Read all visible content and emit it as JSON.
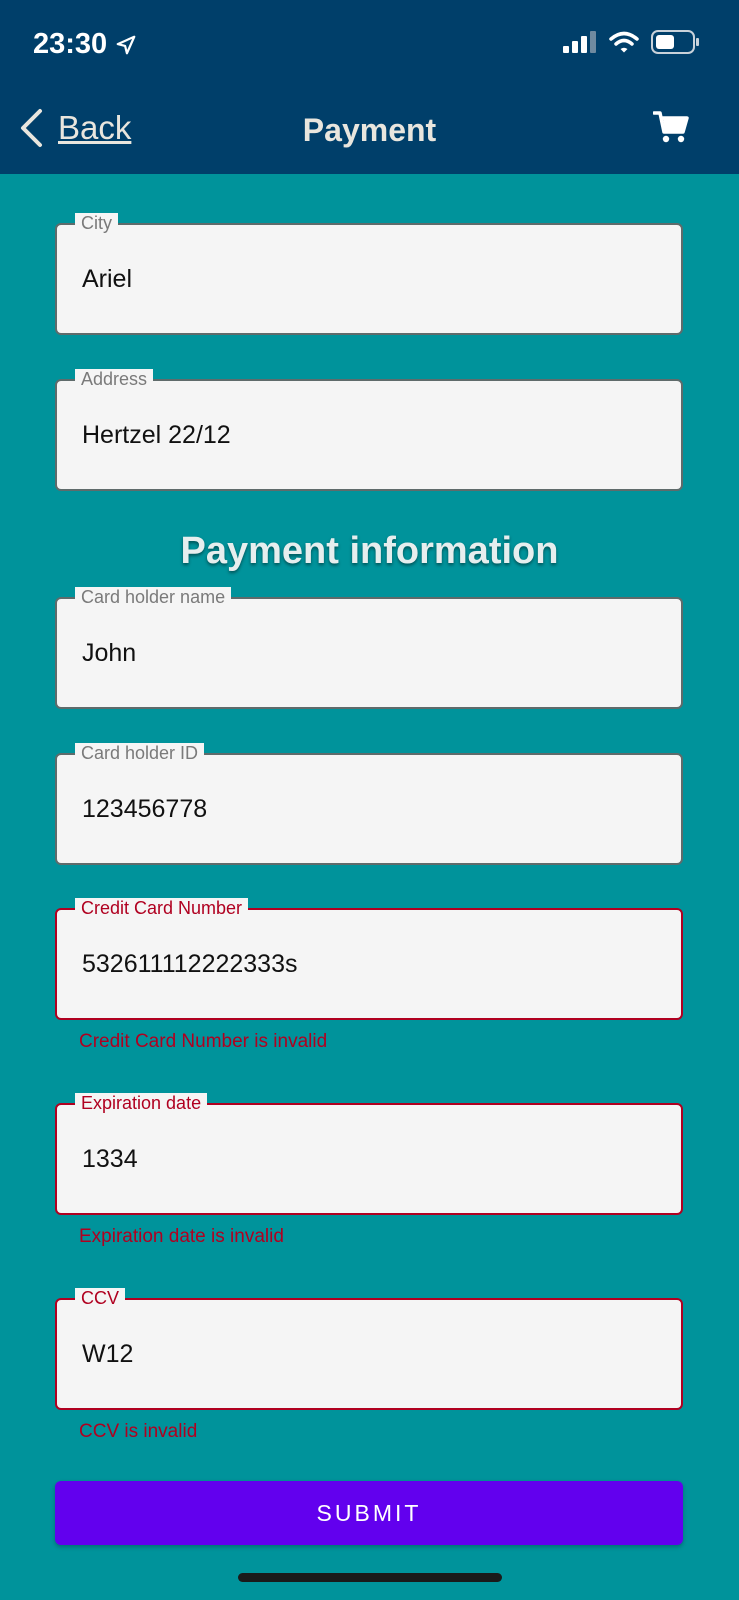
{
  "status_bar": {
    "time": "23:30"
  },
  "nav": {
    "back_label": "Back",
    "title": "Payment"
  },
  "fields": {
    "city": {
      "label": "City",
      "value": "Ariel"
    },
    "address": {
      "label": "Address",
      "value": "Hertzel 22/12"
    },
    "card_holder_name": {
      "label": "Card holder name",
      "value": "John"
    },
    "card_holder_id": {
      "label": "Card holder ID",
      "value": "123456778"
    },
    "credit_card_number": {
      "label": "Credit Card Number",
      "value": "532611112222333s",
      "error": "Credit Card Number is invalid"
    },
    "expiration_date": {
      "label": "Expiration date",
      "value": "1334",
      "error": "Expiration date is invalid"
    },
    "ccv": {
      "label": "CCV",
      "value": "W12",
      "error": "CCV is invalid"
    }
  },
  "section": {
    "payment_information": "Payment information"
  },
  "submit_label": "SUBMIT",
  "colors": {
    "header": "#003f6a",
    "background": "#00939b",
    "error": "#b00020",
    "primary": "#6200ee"
  }
}
